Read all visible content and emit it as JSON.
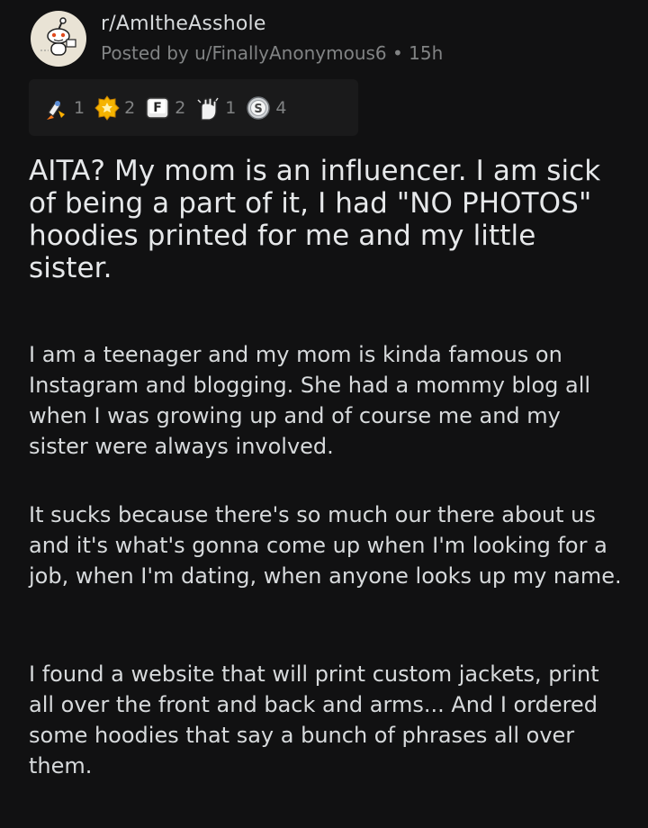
{
  "post": {
    "subreddit": "r/AmItheAsshole",
    "posted_by": "Posted by u/FinallyAnonymous6 • 15h",
    "awards": [
      {
        "icon": "rocket-like-award-icon",
        "count": "1"
      },
      {
        "icon": "gold-award-icon",
        "count": "2"
      },
      {
        "icon": "press-f-award-icon",
        "count": "2"
      },
      {
        "icon": "wholesome-hands-award-icon",
        "count": "1"
      },
      {
        "icon": "silver-award-icon",
        "count": "4"
      }
    ],
    "title": "AITA? My mom is an influencer. I am sick of being a part of it, I had \"NO PHOTOS\" hoodies printed for me and my little sister.",
    "body": [
      "I am a teenager and my mom is kinda famous on Instagram and blogging. She had a mommy blog all when I was growing up and of course me and my sister were always involved.",
      "It sucks because there's so much our there about us and it's what's gonna come up when I'm looking for a job, when I'm dating, when anyone looks up my name.",
      "I found a website that will print custom jackets, print all over the front and back and arms... And I ordered some hoodies that say a bunch of phrases all over them."
    ]
  },
  "colors": {
    "background": "#111112",
    "text": "#d7dadc",
    "muted": "#818384",
    "award_bar": "#1a1a1b"
  }
}
